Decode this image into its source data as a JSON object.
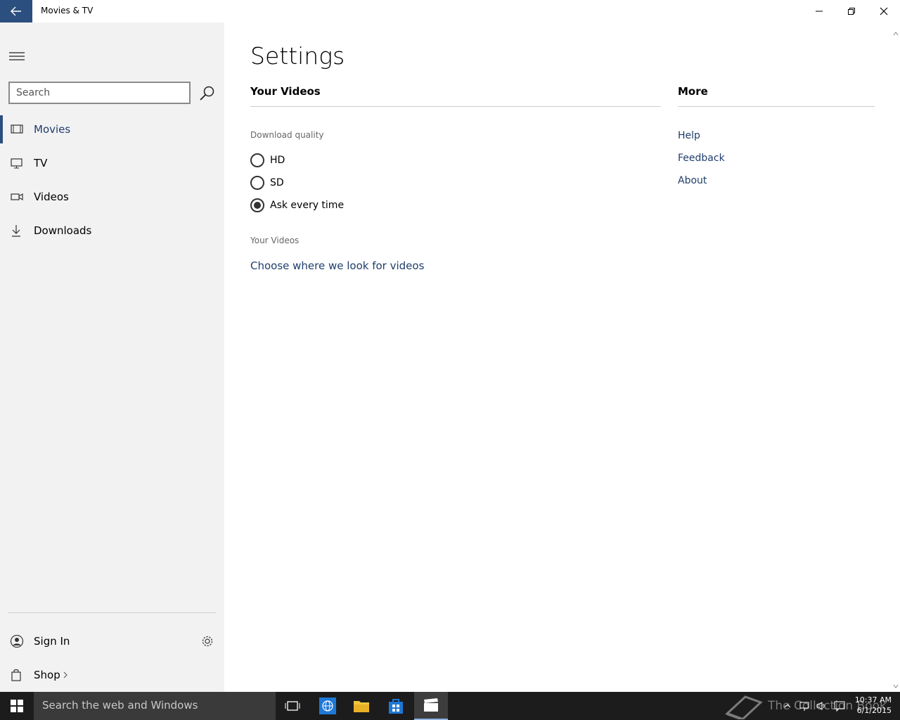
{
  "window": {
    "title": "Movies & TV"
  },
  "nav": {
    "search_placeholder": "Search",
    "items": [
      {
        "label": "Movies",
        "icon": "film-icon",
        "selected": true
      },
      {
        "label": "TV",
        "icon": "monitor-icon",
        "selected": false
      },
      {
        "label": "Videos",
        "icon": "video-camera-icon",
        "selected": false
      },
      {
        "label": "Downloads",
        "icon": "download-icon",
        "selected": false
      }
    ],
    "sign_in": "Sign In",
    "shop": "Shop"
  },
  "settings": {
    "title": "Settings",
    "your_videos_header": "Your Videos",
    "more_header": "More",
    "download_quality_label": "Download quality",
    "quality_options": [
      {
        "label": "HD",
        "checked": false
      },
      {
        "label": "SD",
        "checked": false
      },
      {
        "label": "Ask every time",
        "checked": true
      }
    ],
    "your_videos_label": "Your Videos",
    "choose_link": "Choose where we look for videos",
    "more_links": [
      "Help",
      "Feedback",
      "About"
    ]
  },
  "taskbar": {
    "search_text": "Search the web and Windows",
    "watermark": "The Collection Book",
    "time": "10:37 AM",
    "date": "6/1/2015"
  },
  "colors": {
    "accent": "#2b4f7e",
    "link": "#1f3d6b",
    "nav_bg": "#f2f2f2",
    "taskbar_bg": "#1c1c1c"
  }
}
